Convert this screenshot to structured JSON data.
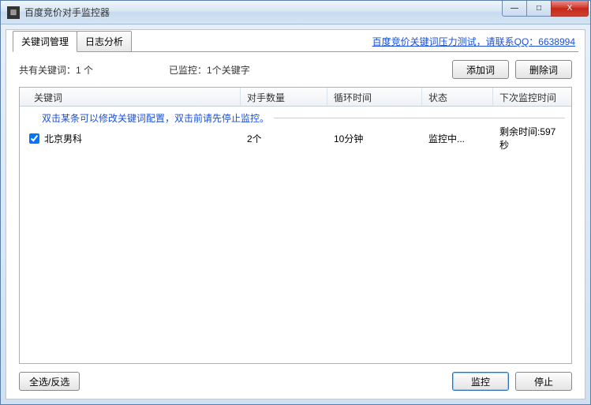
{
  "window": {
    "title": "百度竞价对手监控器",
    "controls": {
      "min": "—",
      "max": "□",
      "close": "X"
    }
  },
  "toplink": "百度竞价关键词压力测试，请联系QQ：6638994",
  "tabs": [
    {
      "label": "关键词管理",
      "active": true
    },
    {
      "label": "日志分析",
      "active": false
    }
  ],
  "toolbar": {
    "total_label": "共有关键词：1 个",
    "monitored_label": "已监控：1个关键字",
    "add_btn": "添加词",
    "del_btn": "删除词"
  },
  "columns": {
    "c1": "关键词",
    "c2": "对手数量",
    "c3": "循环时间",
    "c4": "状态",
    "c5": "下次监控时间"
  },
  "hint": "双击某条可以修改关键词配置，双击前请先停止监控。",
  "rows": [
    {
      "checked": true,
      "keyword": "北京男科",
      "opponents": "2个",
      "cycle": "10分钟",
      "status": "监控中...",
      "next": "剩余时间:597秒"
    }
  ],
  "bottom": {
    "select_all": "全选/反选",
    "monitor": "监控",
    "stop": "停止"
  }
}
